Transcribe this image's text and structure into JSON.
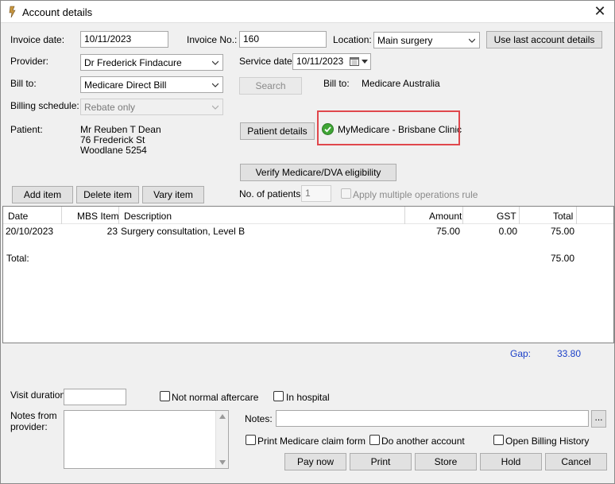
{
  "window": {
    "title": "Account details"
  },
  "form": {
    "invoice_date_label": "Invoice date:",
    "invoice_date_value": "10/11/2023",
    "invoice_no_label": "Invoice No.:",
    "invoice_no_value": "160",
    "location_label": "Location:",
    "location_value": "Main surgery",
    "use_last_account_button": "Use last account details",
    "provider_label": "Provider:",
    "provider_value": "Dr Frederick Findacure",
    "service_date_label": "Service date:",
    "service_date_value": "10/11/2023",
    "bill_to_label": "Bill to:",
    "bill_to_value": "Medicare Direct Bill",
    "search_button": "Search",
    "bill_to_label_right": "Bill to:",
    "bill_to_right_value": "Medicare Australia",
    "billing_schedule_label": "Billing schedule:",
    "billing_schedule_value": "Rebate only",
    "patient_label": "Patient:",
    "patient_line1": "Mr Reuben T Dean",
    "patient_line2": "76 Frederick St",
    "patient_line3": "Woodlane  5254",
    "patient_details_button": "Patient details",
    "mymedicare_text": "MyMedicare - Brisbane Clinic",
    "verify_button": "Verify Medicare/DVA eligibility",
    "add_item_button": "Add item",
    "delete_item_button": "Delete item",
    "vary_item_button": "Vary item",
    "no_of_patients_label": "No. of patients:",
    "no_of_patients_value": "1",
    "apply_multiple_label": "Apply multiple operations rule"
  },
  "table": {
    "headers": [
      "Date",
      "MBS Item",
      "Description",
      "Amount",
      "GST",
      "Total"
    ],
    "rows": [
      {
        "date": "20/10/2023",
        "mbs": "23",
        "description": "Surgery consultation, Level B",
        "amount": "75.00",
        "gst": "0.00",
        "total": "75.00"
      }
    ],
    "total_label": "Total:",
    "total_value": "75.00"
  },
  "gap": {
    "label": "Gap:",
    "value": "33.80"
  },
  "bottom": {
    "visit_duration_label": "Visit duration:",
    "not_normal_aftercare": "Not normal aftercare",
    "in_hospital": "In hospital",
    "notes_from_provider_label_1": "Notes from",
    "notes_from_provider_label_2": "provider:",
    "notes_label": "Notes:",
    "ellipsis_button": "...",
    "print_medicare_claim_form": "Print Medicare claim form",
    "do_another_account": "Do another account",
    "open_billing_history": "Open Billing History"
  },
  "actions": {
    "pay_now": "Pay now",
    "print": "Print",
    "store": "Store",
    "hold": "Hold",
    "cancel": "Cancel"
  },
  "colors": {
    "highlight_border": "#e0474c",
    "gap_text": "#1a3fc8",
    "check_green": "#3fa535"
  }
}
